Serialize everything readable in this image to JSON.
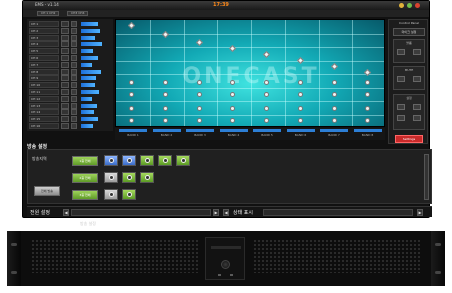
{
  "window": {
    "title": "EMS - v1.14",
    "clock": "17:39",
    "tabs": [
      "CH 1 CH2",
      "CH3 CH4"
    ]
  },
  "channels": [
    {
      "label": "CH 1",
      "level": 0.55
    },
    {
      "label": "CH 2",
      "level": 0.62
    },
    {
      "label": "CH 3",
      "level": 0.48
    },
    {
      "label": "CH 4",
      "level": 0.7
    },
    {
      "label": "CH 5",
      "level": 0.4
    },
    {
      "label": "CH 6",
      "level": 0.58
    },
    {
      "label": "CH 7",
      "level": 0.35
    },
    {
      "label": "CH 8",
      "level": 0.66
    },
    {
      "label": "CH 9",
      "level": 0.5
    },
    {
      "label": "CH 10",
      "level": 0.45
    },
    {
      "label": "CH 11",
      "level": 0.6
    },
    {
      "label": "CH 12",
      "level": 0.38
    },
    {
      "label": "CH 13",
      "level": 0.52
    },
    {
      "label": "CH 14",
      "level": 0.44
    },
    {
      "label": "CH 15",
      "level": 0.57
    },
    {
      "label": "CH 16",
      "level": 0.41
    }
  ],
  "graph": {
    "logo": "ONECAST",
    "band_labels": [
      "BAND 1",
      "BAND 2",
      "BAND 3",
      "BAND 4",
      "BAND 5",
      "BAND 6",
      "BAND 7",
      "BAND 8"
    ]
  },
  "right_panel": {
    "title": "Control Panel",
    "buttons": [
      "마이크 설정",
      "볼륨",
      "MUTE",
      "설정"
    ],
    "red_button": "Settings"
  },
  "section_title": "방송 설정",
  "zones": {
    "title": "방송지역",
    "row_buttons": [
      "1층 전체",
      "2층 전체",
      "3층 전체"
    ],
    "side_button": "전체 방송"
  },
  "bottom": {
    "left_label": "전원 설정",
    "field_text": "방송 설정",
    "right_label": "상태 표시"
  },
  "colors": {
    "graph": "#12a9b5",
    "meter": "#2d7fd6",
    "accent_green": "#7ab83e",
    "clock": "#ff8a1a",
    "alert": "#c92a2a"
  }
}
